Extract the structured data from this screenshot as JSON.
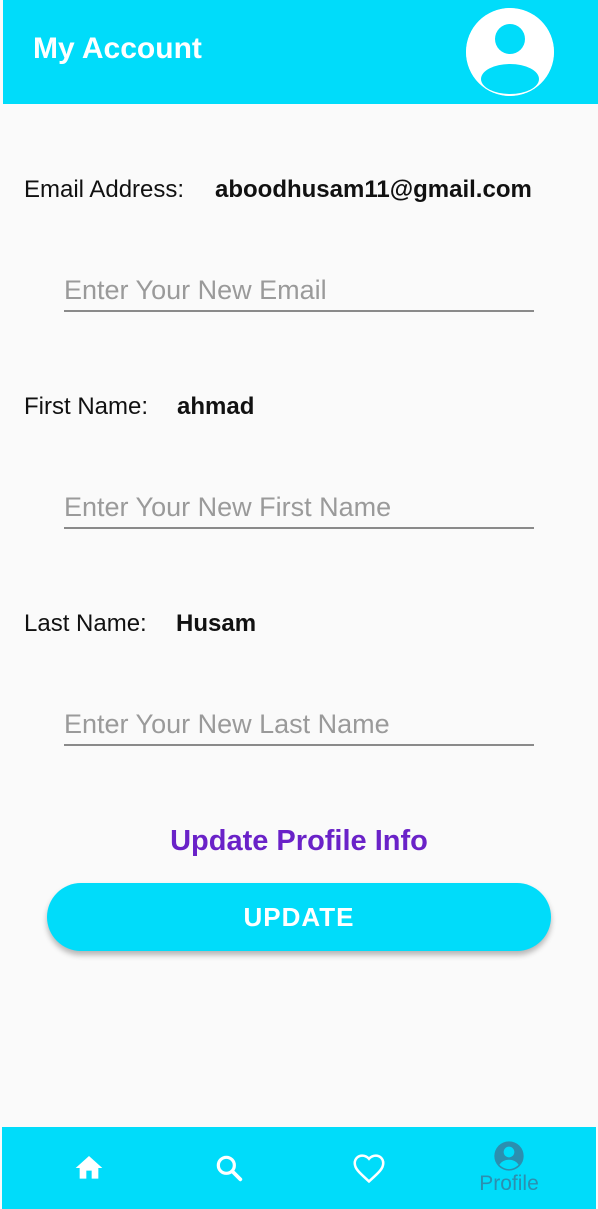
{
  "appbar": {
    "title": "My Account",
    "avatar_icon": "account-circle-icon"
  },
  "email": {
    "label": "Email Address:",
    "value": "aboodhusam11@gmail.com",
    "placeholder": "Enter Your New Email"
  },
  "first_name": {
    "label": "First Name:",
    "value": "ahmad",
    "placeholder": "Enter Your New First Name"
  },
  "last_name": {
    "label": "Last Name:",
    "value": "Husam",
    "placeholder": "Enter Your New Last Name"
  },
  "update_section": {
    "title": "Update Profile Info",
    "button_label": "UPDATE"
  },
  "bottom_nav": {
    "items": [
      {
        "icon": "home-icon",
        "label": ""
      },
      {
        "icon": "search-icon",
        "label": ""
      },
      {
        "icon": "heart-icon",
        "label": ""
      },
      {
        "icon": "profile-icon",
        "label": "Profile"
      }
    ]
  },
  "colors": {
    "accent": "#00dcfa",
    "section_title": "#6a22c8",
    "active_nav": "#2b8fb0"
  }
}
